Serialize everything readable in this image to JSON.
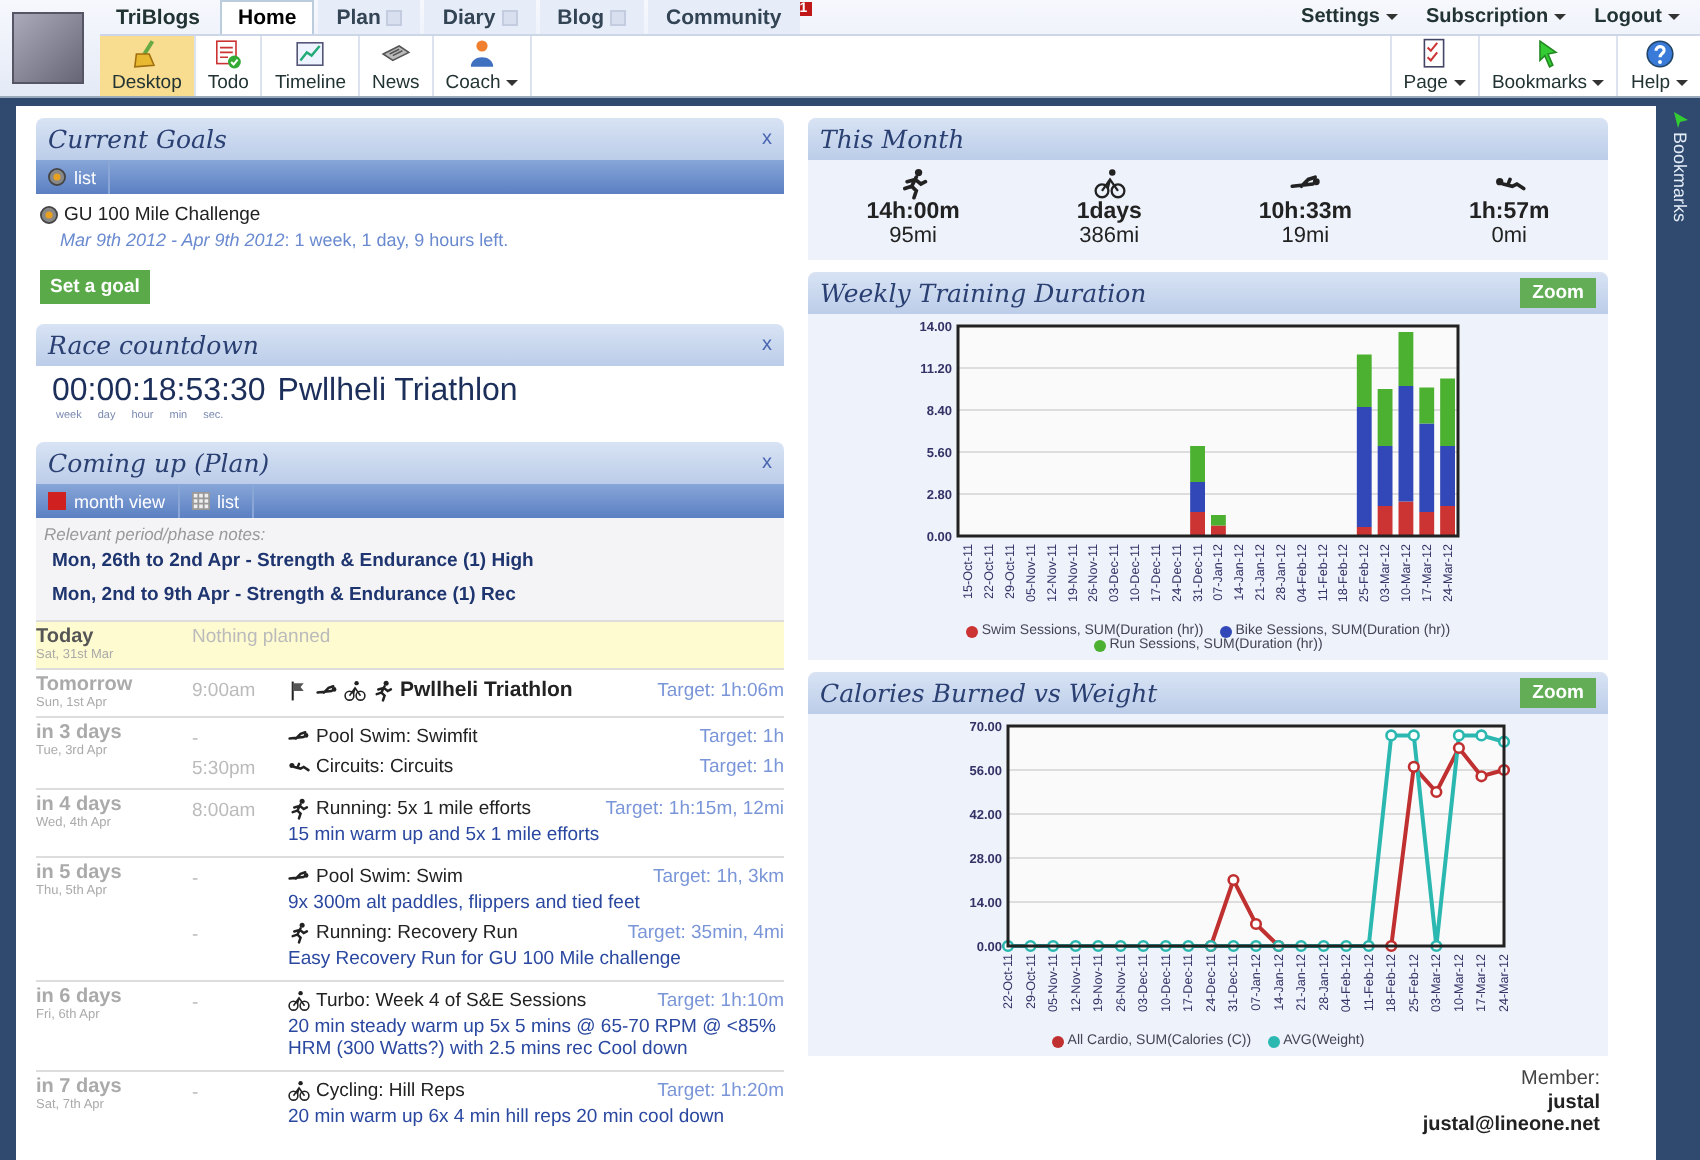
{
  "header": {
    "site_name": "TriBlogs",
    "tabs": [
      {
        "label": "Home",
        "selected": true,
        "dropdown": false
      },
      {
        "label": "Plan",
        "selected": false,
        "dropdown": true
      },
      {
        "label": "Diary",
        "selected": false,
        "dropdown": true
      },
      {
        "label": "Blog",
        "selected": false,
        "dropdown": true
      },
      {
        "label": "Community",
        "selected": false,
        "dropdown": false,
        "badge": "1"
      }
    ],
    "user_menu": [
      "Settings",
      "Subscription",
      "Logout"
    ],
    "toolbar": [
      {
        "label": "Desktop",
        "selected": true,
        "dropdown": false
      },
      {
        "label": "Todo",
        "selected": false,
        "dropdown": false
      },
      {
        "label": "Timeline",
        "selected": false,
        "dropdown": false
      },
      {
        "label": "News",
        "selected": false,
        "dropdown": false
      },
      {
        "label": "Coach",
        "selected": false,
        "dropdown": true
      }
    ],
    "toolbar_right": [
      "Page",
      "Bookmarks",
      "Help"
    ]
  },
  "current_goals": {
    "title": "Current Goals",
    "close": "x",
    "views": [
      "list"
    ],
    "goals": [
      {
        "name": "GU 100 Mile Challenge",
        "period": "*Mar 9th 2012 - Apr 9th 2012*: 1 week, 1 day, 9 hours left."
      }
    ],
    "button": "Set a goal"
  },
  "race_countdown": {
    "title": "Race countdown",
    "close": "x",
    "time": "00:00:18:53:30",
    "event": "Pwllheli Triathlon",
    "units": [
      "week",
      "day",
      "hour",
      "min",
      "sec."
    ]
  },
  "coming_up": {
    "title": "Coming up (Plan)",
    "close": "x",
    "views": [
      "month view",
      "list"
    ],
    "notes_label": "Relevant period/phase notes:",
    "notes": [
      "Mon, 26th to 2nd Apr - Strength & Endurance (1) High",
      "Mon, 2nd to 9th Apr - Strength & Endurance (1) Rec"
    ],
    "days": [
      {
        "day": "Today",
        "date": "Sat, 31st Mar",
        "highlighted": true,
        "empty": "Nothing planned"
      },
      {
        "day": "Tomorrow",
        "date": "Sun, 1st Apr",
        "highlighted": false,
        "entries": [
          {
            "time": "9:00am",
            "kind": "race",
            "title": "Pwllheli Triathlon",
            "target": "Target: 1h:06m"
          }
        ]
      },
      {
        "day": "in 3 days",
        "date": "Tue, 3rd Apr",
        "highlighted": false,
        "entries": [
          {
            "time": "-",
            "kind": "swim",
            "title": "Pool Swim: Swimfit",
            "target": "Target: 1h"
          },
          {
            "time": "5:30pm",
            "kind": "circuits",
            "title": "Circuits: Circuits",
            "target": "Target: 1h"
          }
        ]
      },
      {
        "day": "in 4 days",
        "date": "Wed, 4th Apr",
        "highlighted": false,
        "entries": [
          {
            "time": "8:00am",
            "kind": "run",
            "title": "Running: 5x 1 mile efforts",
            "target": "Target: 1h:15m, 12mi",
            "description": "15 min warm up and 5x 1 mile efforts"
          }
        ]
      },
      {
        "day": "in 5 days",
        "date": "Thu, 5th Apr",
        "highlighted": false,
        "entries": [
          {
            "time": "-",
            "kind": "swim",
            "title": "Pool Swim: Swim",
            "target": "Target: 1h, 3km",
            "description": "9x 300m alt paddles, flippers and tied feet"
          },
          {
            "time": "-",
            "kind": "run",
            "title": "Running: Recovery Run",
            "target": "Target: 35min, 4mi",
            "description": "Easy Recovery Run for GU 100 Mile challenge"
          }
        ]
      },
      {
        "day": "in 6 days",
        "date": "Fri, 6th Apr",
        "highlighted": false,
        "entries": [
          {
            "time": "-",
            "kind": "bike",
            "title": "Turbo: Week 4 of S&E Sessions",
            "target": "Target: 1h:10m",
            "description": "20 min steady warm up 5x 5 mins @ 65-70 RPM @ <85% HRM (300 Watts?) with 2.5 mins rec Cool down"
          }
        ]
      },
      {
        "day": "in 7 days",
        "date": "Sat, 7th Apr",
        "highlighted": false,
        "entries": [
          {
            "time": "-",
            "kind": "bike",
            "title": "Cycling: Hill Reps",
            "target": "Target: 1h:20m",
            "description": "20 min warm up 6x 4 min hill reps 20 min cool down"
          }
        ]
      }
    ]
  },
  "this_month": {
    "title": "This Month",
    "stats": [
      {
        "kind": "run",
        "time": "14h:00m",
        "distance": "95mi"
      },
      {
        "kind": "bike",
        "time": "1days",
        "distance": "386mi"
      },
      {
        "kind": "swim",
        "time": "10h:33m",
        "distance": "19mi"
      },
      {
        "kind": "circuits",
        "time": "1h:57m",
        "distance": "0mi"
      }
    ]
  },
  "weekly_training": {
    "title": "Weekly Training Duration",
    "button": "Zoom",
    "chart_data": {
      "type": "bar",
      "stacked": true,
      "grid": true,
      "legend": "bottom",
      "categories": [
        "15-Oct-11",
        "22-Oct-11",
        "29-Oct-11",
        "05-Nov-11",
        "12-Nov-11",
        "19-Nov-11",
        "26-Nov-11",
        "03-Dec-11",
        "10-Dec-11",
        "17-Dec-11",
        "24-Dec-11",
        "31-Dec-11",
        "07-Jan-12",
        "14-Jan-12",
        "21-Jan-12",
        "28-Jan-12",
        "04-Feb-12",
        "11-Feb-12",
        "18-Feb-12",
        "25-Feb-12",
        "03-Mar-12",
        "10-Mar-12",
        "17-Mar-12",
        "24-Mar-12"
      ],
      "series": [
        {
          "name": "Swim Sessions, SUM(Duration (hr))",
          "color": "#cc3333",
          "values": [
            0,
            0,
            0,
            0,
            0,
            0,
            0,
            0,
            0,
            0,
            0,
            1.6,
            0.7,
            0,
            0,
            0,
            0,
            0,
            0,
            0.6,
            2.0,
            2.3,
            1.6,
            2.0
          ]
        },
        {
          "name": "Bike Sessions, SUM(Duration (hr))",
          "color": "#3348b8",
          "values": [
            0,
            0,
            0,
            0,
            0,
            0,
            0,
            0,
            0,
            0,
            0,
            2.0,
            0,
            0,
            0,
            0,
            0,
            0,
            0,
            8.0,
            4.0,
            7.7,
            5.9,
            4.0
          ]
        },
        {
          "name": "Run Sessions, SUM(Duration (hr))",
          "color": "#4cb030",
          "values": [
            0,
            0,
            0,
            0,
            0,
            0,
            0,
            0,
            0,
            0,
            0,
            2.4,
            0.7,
            0,
            0,
            0,
            0,
            0,
            0,
            3.5,
            3.8,
            3.6,
            2.4,
            4.5
          ]
        }
      ],
      "ylim": [
        0,
        14
      ],
      "yticks": [
        {
          "value": 0,
          "label": "0.00"
        },
        {
          "value": 2.8,
          "label": "2.80"
        },
        {
          "value": 5.6,
          "label": "5.60"
        },
        {
          "value": 8.4,
          "label": "8.40"
        },
        {
          "value": 11.2,
          "label": "11.20"
        },
        {
          "value": 14,
          "label": "14.00"
        }
      ]
    }
  },
  "calories_weight": {
    "title": "Calories Burned vs Weight",
    "button": "Zoom",
    "chart_data": {
      "type": "line",
      "grid": true,
      "legend": "bottom",
      "categories": [
        "22-Oct-11",
        "29-Oct-11",
        "05-Nov-11",
        "12-Nov-11",
        "19-Nov-11",
        "26-Nov-11",
        "03-Dec-11",
        "10-Dec-11",
        "17-Dec-11",
        "24-Dec-11",
        "31-Dec-11",
        "07-Jan-12",
        "14-Jan-12",
        "21-Jan-12",
        "28-Jan-12",
        "04-Feb-12",
        "11-Feb-12",
        "18-Feb-12",
        "25-Feb-12",
        "03-Mar-12",
        "10-Mar-12",
        "17-Mar-12",
        "24-Mar-12"
      ],
      "series": [
        {
          "name": "All Cardio, SUM(Calories (C))",
          "color": "#c03030",
          "marker": "circle",
          "values": [
            null,
            null,
            null,
            null,
            null,
            null,
            null,
            null,
            null,
            0,
            21,
            7,
            0,
            null,
            null,
            null,
            null,
            0,
            57,
            49,
            63,
            54,
            56
          ]
        },
        {
          "name": "AVG(Weight)",
          "color": "#2ab8b0",
          "marker": "circle",
          "values": [
            0,
            0,
            0,
            0,
            0,
            0,
            0,
            0,
            0,
            0,
            0,
            0,
            0,
            0,
            0,
            0,
            0,
            67,
            67,
            0,
            67,
            67,
            65
          ]
        }
      ],
      "ylim": [
        0,
        70
      ],
      "yticks": [
        {
          "value": 0,
          "label": "0.00"
        },
        {
          "value": 14,
          "label": "14.00"
        },
        {
          "value": 28,
          "label": "28.00"
        },
        {
          "value": 42,
          "label": "42.00"
        },
        {
          "value": 56,
          "label": "56.00"
        },
        {
          "value": 70,
          "label": "70.00"
        }
      ]
    }
  },
  "member": {
    "label": "Member:",
    "name": "justal",
    "email": "justal@lineone.net"
  },
  "side_tab": {
    "label": "Bookmarks"
  }
}
